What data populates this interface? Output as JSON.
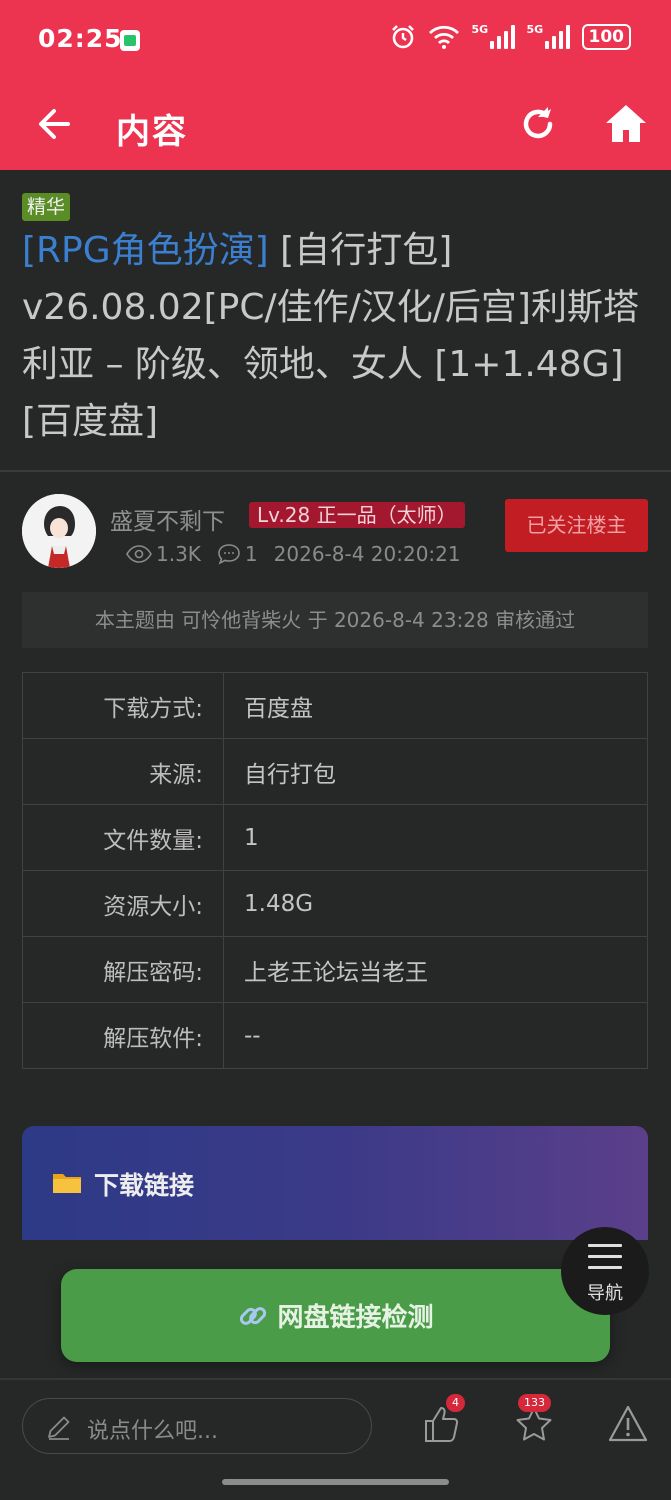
{
  "status_bar": {
    "time": "02:25",
    "battery": "100",
    "network": "5G"
  },
  "app_bar": {
    "title": "内容"
  },
  "thread": {
    "badge": "精华",
    "category": "[RPG角色扮演]",
    "title": " [自行打包] v26.08.02[PC/佳作/汉化/后宫]利斯塔利亚 – 阶级、领地、女人 [1+1.48G][百度盘]"
  },
  "author": {
    "name": "盛夏不剩下",
    "level": "Lv.28 正一品（太师）",
    "follow_label": "已关注楼主",
    "views": "1.3K",
    "comments": "1",
    "datetime": "2026-8-4 20:20:21"
  },
  "audit_note": "本主题由 可怜他背柴火 于 2026-8-4 23:28 审核通过",
  "info_table": [
    {
      "key": "下载方式:",
      "value": "百度盘"
    },
    {
      "key": "来源:",
      "value": "自行打包"
    },
    {
      "key": "文件数量:",
      "value": "1"
    },
    {
      "key": "资源大小:",
      "value": "1.48G"
    },
    {
      "key": "解压密码:",
      "value": "上老王论坛当老王"
    },
    {
      "key": "解压软件:",
      "value": "--"
    }
  ],
  "download": {
    "title": "下载链接",
    "icon": "folder-icon"
  },
  "nav_fab": {
    "label": "导航"
  },
  "check_button": {
    "label": "网盘链接检测",
    "icon": "link-icon"
  },
  "bottom_bar": {
    "comment_placeholder": "说点什么吧...",
    "like_count": "4",
    "favorite_count": "133"
  },
  "colors": {
    "header": "#ec3350",
    "background": "#262727",
    "category_link": "#3a7fd0",
    "check_button": "#4b9c48",
    "level_badge": "#a3182f"
  }
}
